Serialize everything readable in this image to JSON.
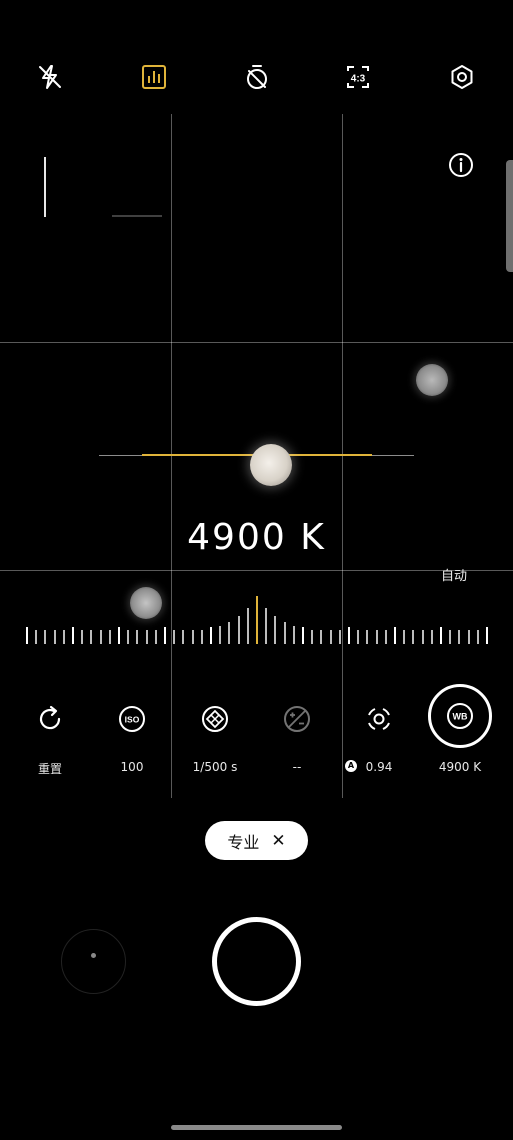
{
  "top_bar": {
    "icons": [
      "flash-off-icon",
      "histogram-icon",
      "timer-off-icon",
      "aspect-ratio-icon",
      "settings-icon"
    ],
    "aspect_ratio_label": "4:3",
    "histogram_color": "#e0b43a"
  },
  "viewfinder": {
    "info_icon": "info-icon",
    "white_balance_readout": "4900 K",
    "auto_label": "自动",
    "accent_color": "#e0b43a"
  },
  "pro_controls": [
    {
      "id": "reset",
      "icon": "reset-icon",
      "value": "重置"
    },
    {
      "id": "iso",
      "icon": "iso-icon",
      "value": "100"
    },
    {
      "id": "shutter-speed",
      "icon": "shutter-speed-icon",
      "value": "1/500 s"
    },
    {
      "id": "exposure-compensation",
      "icon": "exposure-compensation-icon",
      "value": "--"
    },
    {
      "id": "focus",
      "icon": "focus-icon",
      "value": "0.94",
      "badge": "A"
    },
    {
      "id": "white-balance",
      "icon": "wb-icon",
      "icon_label": "WB",
      "value": "4900 K",
      "selected": true
    }
  ],
  "mode_chip": {
    "label": "专业",
    "close_symbol": "✕"
  }
}
